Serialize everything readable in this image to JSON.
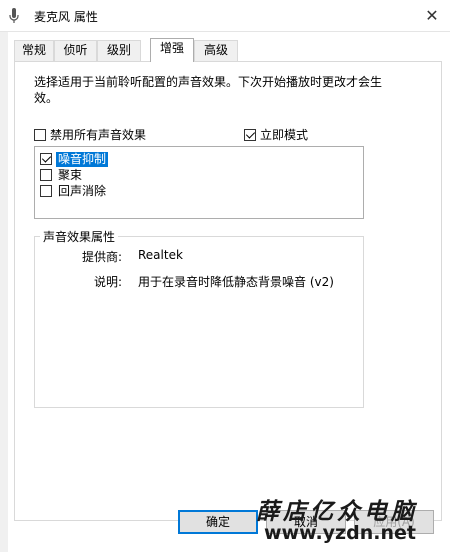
{
  "window": {
    "title": "麦克风 属性",
    "close_glyph": "✕",
    "mic_icon": "microphone-icon"
  },
  "tabs": [
    {
      "label": "常规",
      "active": false
    },
    {
      "label": "侦听",
      "active": false
    },
    {
      "label": "级别",
      "active": false
    },
    {
      "label": "增强",
      "active": true
    },
    {
      "label": "高级",
      "active": false
    }
  ],
  "enhancements": {
    "description_line1": "选择适用于当前聆听配置的声音效果。下次开始播放时更改才会生",
    "description_line2": "效。",
    "disable_all": {
      "label": "禁用所有声音效果",
      "checked": false
    },
    "immediate_mode": {
      "label": "立即模式",
      "checked": true
    },
    "effects": [
      {
        "label": "噪音抑制",
        "checked": true,
        "selected": true
      },
      {
        "label": "聚束",
        "checked": false,
        "selected": false
      },
      {
        "label": "回声消除",
        "checked": false,
        "selected": false
      }
    ]
  },
  "properties": {
    "group_title": "声音效果属性",
    "provider_label": "提供商:",
    "provider_value": "Realtek",
    "desc_label": "说明:",
    "desc_value": "用于在录音时降低静态背景噪音 (v2)"
  },
  "buttons": {
    "ok": "确定",
    "cancel": "取消",
    "apply": "应用(A)"
  },
  "watermark": {
    "text_cn": "薛店亿众电脑",
    "url": "www.yzdn.net"
  }
}
